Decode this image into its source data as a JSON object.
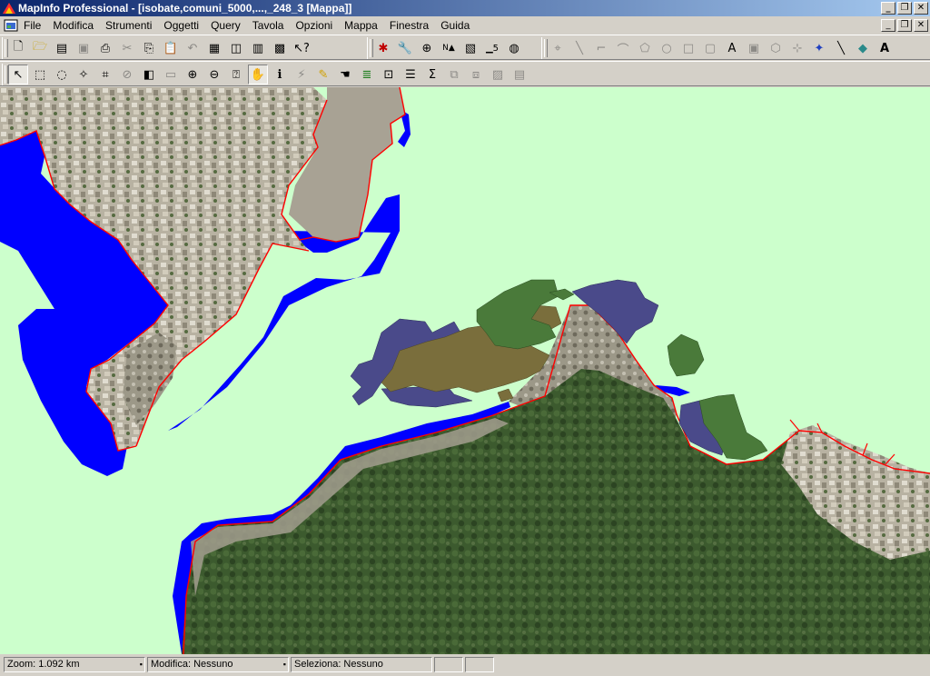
{
  "window": {
    "title": "MapInfo Professional - [isobate,comuni_5000,...,_248_3 [Mappa]]"
  },
  "menu": [
    "File",
    "Modifica",
    "Strumenti",
    "Oggetti",
    "Query",
    "Tavola",
    "Opzioni",
    "Mappa",
    "Finestra",
    "Guida"
  ],
  "status": {
    "zoom": "Zoom: 1.092 km",
    "modifica": "Modifica: Nessuno",
    "seleziona": "Seleziona: Nessuno"
  },
  "colors": {
    "sea": "#ccffcc",
    "depth_band": "#0000ff",
    "coastline": "#ff0000",
    "habitat_dark_blue": "#4a4a8a",
    "habitat_olive": "#7a6e3c",
    "habitat_green": "#4a7a3a"
  }
}
